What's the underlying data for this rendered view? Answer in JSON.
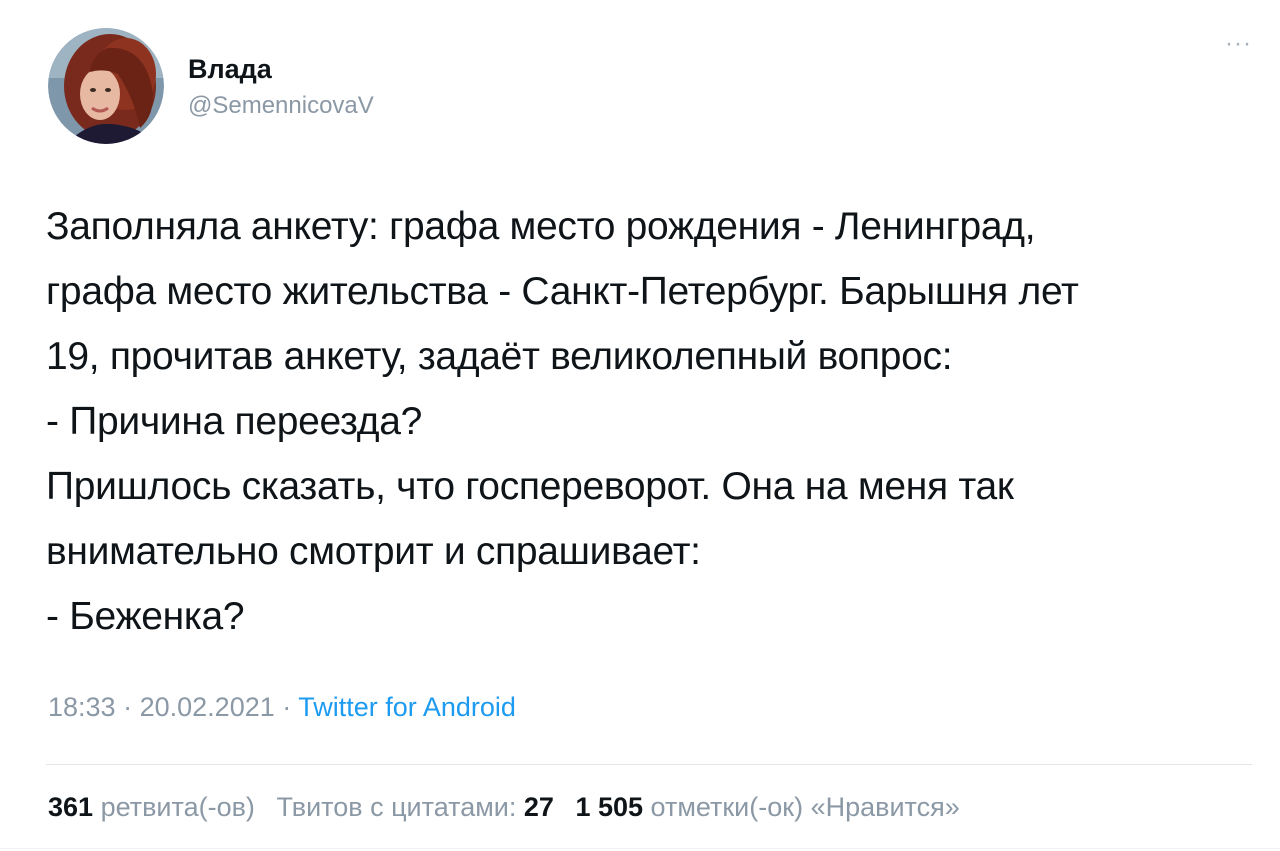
{
  "user": {
    "display_name": "Влада",
    "handle": "@SemennicovaV"
  },
  "more_icon": "more-dots-icon",
  "tweet": {
    "lines": [
      "Заполняла анкету: графа место рождения - Ленинград,",
      "графа место жительства - Санкт-Петербург. Барышня лет",
      "19, прочитав анкету, задаёт великолепный вопрос:",
      "- Причина переезда?",
      "Пришлось сказать, что госпереворот. Она на меня так",
      "внимательно смотрит и спрашивает:",
      "- Беженка?"
    ]
  },
  "meta": {
    "time": "18:33",
    "date": "20.02.2021",
    "sep": "·",
    "source": "Twitter for Android"
  },
  "stats": {
    "retweets_count": "361",
    "retweets_label": "ретвита(-ов)",
    "quotes_label": "Твитов с цитатами:",
    "quotes_count": "27",
    "likes_count": "1 505",
    "likes_label": "отметки(-ок) «Нравится»"
  },
  "colors": {
    "text": "#0f1419",
    "secondary": "#8b98a5",
    "link": "#1d9bf0"
  }
}
